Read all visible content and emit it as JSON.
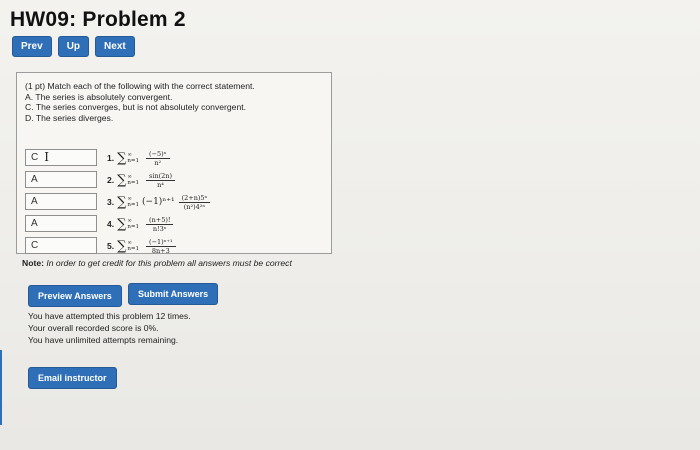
{
  "header": {
    "title": "HW09: Problem 2"
  },
  "nav": {
    "prev": "Prev",
    "up": "Up",
    "next": "Next"
  },
  "problem": {
    "intro": "(1 pt) Match each of the following with the correct statement.",
    "statements": [
      "A. The series is absolutely convergent.",
      "C. The series converges, but is not absolutely convergent.",
      "D. The series diverges."
    ],
    "rows": [
      {
        "answer": "C",
        "num": "1.",
        "lims_top": "∞",
        "lims_bot": "n=1",
        "expr": "",
        "frac_top": "(−5)ⁿ",
        "frac_bot": "n²"
      },
      {
        "answer": "A",
        "num": "2.",
        "lims_top": "∞",
        "lims_bot": "n=1",
        "expr": "",
        "frac_top": "sin(2n)",
        "frac_bot": "n⁴"
      },
      {
        "answer": "A",
        "num": "3.",
        "lims_top": "∞",
        "lims_bot": "n=1",
        "expr": "(−1)ⁿ⁺¹",
        "frac_top": "(2+n)5ⁿ",
        "frac_bot": "(n²)4²ⁿ"
      },
      {
        "answer": "A",
        "num": "4.",
        "lims_top": "∞",
        "lims_bot": "n=1",
        "expr": "",
        "frac_top": "(n+5)!",
        "frac_bot": "n!3ⁿ"
      },
      {
        "answer": "C",
        "num": "5.",
        "lims_top": "∞",
        "lims_bot": "n=1",
        "expr": "",
        "frac_top": "(−1)ⁿ⁺¹",
        "frac_bot": "8n+3"
      }
    ]
  },
  "note": {
    "label": "Note:",
    "text": " In order to get credit for this problem all answers must be correct"
  },
  "buttons": {
    "preview": "Preview Answers",
    "submit": "Submit Answers",
    "email": "Email instructor"
  },
  "attempts": [
    "You have attempted this problem 12 times.",
    "Your overall recorded score is 0%.",
    "You have unlimited attempts remaining."
  ]
}
